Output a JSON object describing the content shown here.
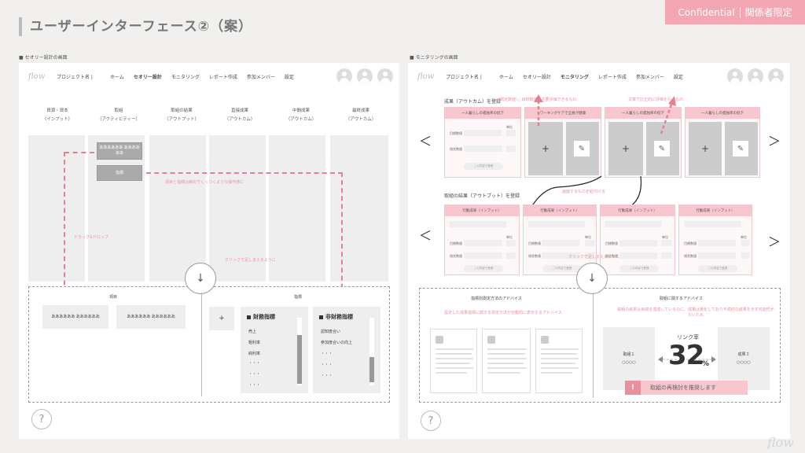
{
  "header": {
    "title": "ユーザーインターフェース②（案）"
  },
  "badge": {
    "left": "Confidential",
    "right": "関係者限定"
  },
  "left": {
    "caption": "■ セオリー設計の画面",
    "logo": "flow",
    "project": "プロジェクト名 |",
    "nav": [
      "ホーム",
      "セオリー設計",
      "モニタリング",
      "レポート作成",
      "参加メンバー",
      "設定"
    ],
    "columns": [
      {
        "l1": "資源・資本",
        "l2": "（インプット）"
      },
      {
        "l1": "取組",
        "l2": "（アクティビティー）"
      },
      {
        "l1": "取組の結果",
        "l2": "（アウトプット）"
      },
      {
        "l1": "直接成果",
        "l2": "（アウトカム）"
      },
      {
        "l1": "中間成果",
        "l2": "（アウトカム）"
      },
      {
        "l1": "最終成果",
        "l2": "（アウトカム）"
      }
    ],
    "gray_box1": "ああああああ ああああああ",
    "gray_box2": "指標",
    "hint_connect": "項目と指標は線のでくっつくような操作感に",
    "hint_drag": "ドラッグ&ドロップ",
    "hint_add": "クリックで足しまえるように",
    "arrow_down": "↓",
    "item_section": "項目",
    "items": [
      "ああああああ ああああああ",
      "ああああああ ああああああ"
    ],
    "indicator_section": "指標",
    "plus": "+",
    "fin_title": "財務指標",
    "fin_items": [
      "売上",
      "粗利率",
      "純利率",
      "・・・",
      "・・・",
      "・・・"
    ],
    "nonfin_title": "非財務指標",
    "nonfin_items": [
      "認知度合い",
      "参加度合いの向上",
      "・・・",
      "・・・",
      "・・・"
    ],
    "help": "?"
  },
  "right": {
    "caption": "■ モニタリングの画面",
    "logo": "flow",
    "project": "プロジェクト名 |",
    "nav": [
      "ホーム",
      "セオリー設計",
      "モニタリング",
      "レポート作成",
      "参加メンバー",
      "設定"
    ],
    "outcome_label": "成果（アウトカム）を登録",
    "outcome_hint1": "（測定数値）」目標数値で主要評価できるもの",
    "outcome_hint2": "文章で訂正的に評価を行うもの",
    "outcome_cards": [
      "一人暮らしの孤独率の低下",
      "ワーキングケアで全員が健康",
      "一人暮らしの孤独率の低下",
      "一人暮らしの孤独率の低下"
    ],
    "card_field1": "目標数値",
    "card_field2": "現状数値",
    "card_unit": "単位",
    "card_btn": "この内容で登録",
    "output_label": "取組の結果（アウトプット）を登録",
    "output_hint": "画面するものを紐付ける",
    "output_cards": [
      "行動成果（インプット）",
      "行動成果（インプット）",
      "行動成果（インプット）",
      "行動成果（インプット）"
    ],
    "add_hint": "クリックで足しまえるように",
    "plus": "+",
    "pencil": "✎",
    "arrow_down": "↓",
    "chev_left": "＜",
    "chev_right": "＞",
    "advice_left_title": "指標別測定方法のアドバイス",
    "advice_left_hint": "設定した成果指標に関する測定方法が自動的に表示するアドバイス",
    "advice_right_title": "取組に関するアドバイス",
    "advice_right_hint": "取組の結果は目標を達成しているのに、成果は悪化しており不適切な結果を示す可能性がないため",
    "link_rate_label": "リンク率",
    "link_rate_value": "32",
    "link_rate_unit": "%",
    "link_left": "取組１",
    "link_left_sub": "○○○○",
    "link_right": "成果３",
    "link_right_sub": "○○○○",
    "alert_text": "取組の再検討を推奨します",
    "help": "?"
  },
  "watermark": "flow"
}
